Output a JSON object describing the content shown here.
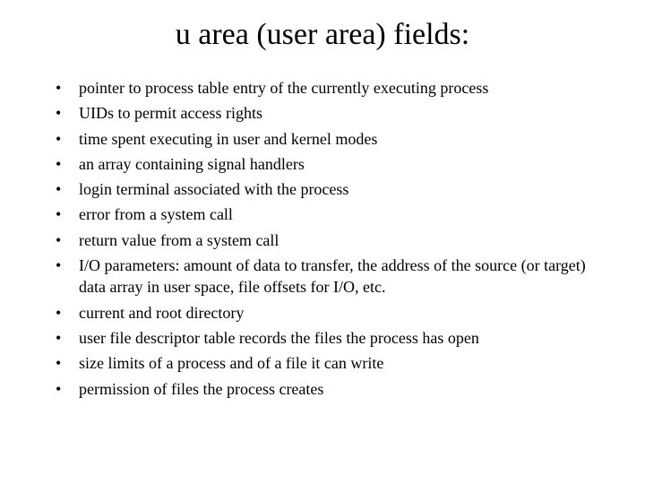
{
  "title": "u area (user area) fields:",
  "items": [
    "pointer to process table entry of the currently executing process",
    "UIDs to permit access rights",
    "time spent executing in user and kernel modes",
    "an array containing signal handlers",
    "login terminal associated with the process",
    "error from a system call",
    "return value from a system call",
    "I/O parameters: amount of data to transfer, the address of the source (or target) data array in user space, file offsets for I/O, etc.",
    "current and root directory",
    "user file descriptor table records the files the process has open",
    "size limits of a process and of a file it can write",
    "permission of files the process creates"
  ]
}
